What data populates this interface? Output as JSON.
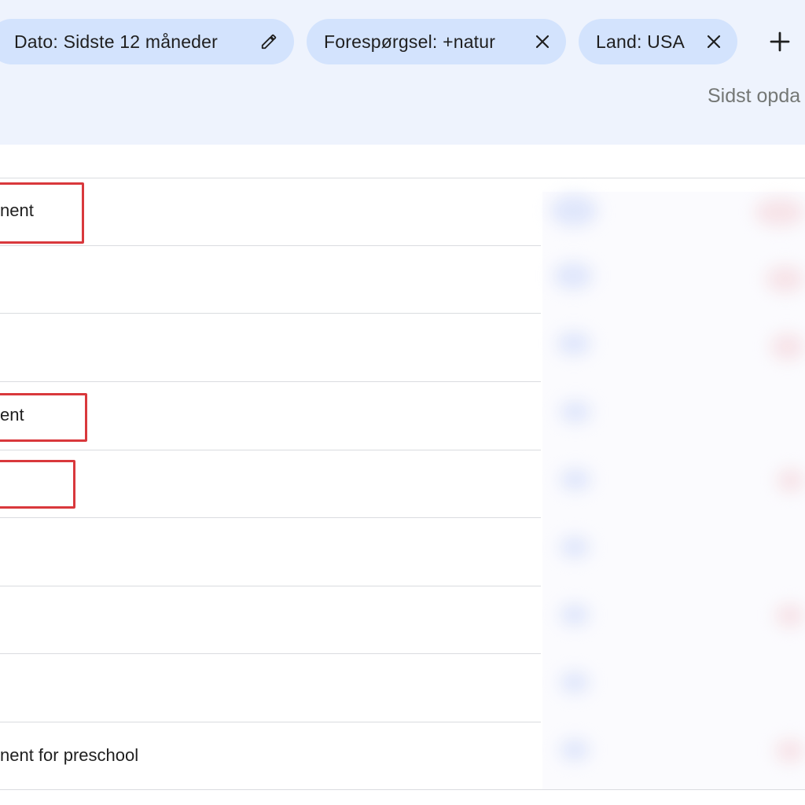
{
  "filters": {
    "date_chip": "Dato: Sidste 12 måneder",
    "query_chip": "Forespørgsel: +natur",
    "country_chip": "Land: USA"
  },
  "header": {
    "last_updated": "Sidst opda"
  },
  "rows": [
    {
      "text": "nent"
    },
    {
      "text": ""
    },
    {
      "text": ""
    },
    {
      "text": "ent"
    },
    {
      "text": ""
    },
    {
      "text": ""
    },
    {
      "text": ""
    },
    {
      "text": ""
    },
    {
      "text": "nent for preschool"
    }
  ],
  "colors": {
    "header_bg": "#eef3fd",
    "chip_bg": "#d3e3fd",
    "highlight": "#d9383c"
  }
}
